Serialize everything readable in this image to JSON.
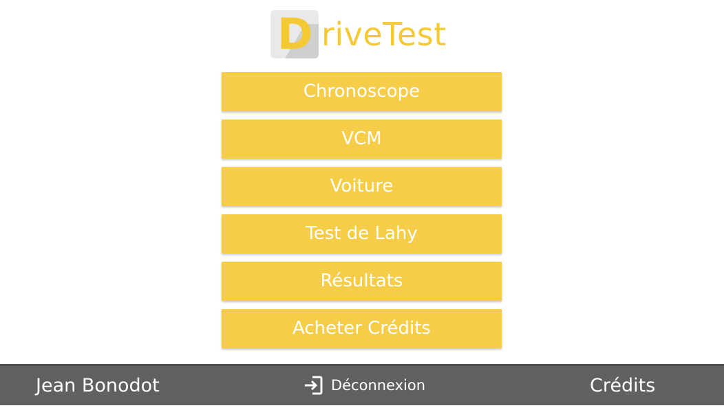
{
  "app": {
    "logo_letter": "D",
    "logo_rest": "riveTest"
  },
  "colors": {
    "accent": "#f5cd48",
    "logo": "#f5c934",
    "footer": "#606060"
  },
  "menu": {
    "items": [
      {
        "label": "Chronoscope"
      },
      {
        "label": "VCM"
      },
      {
        "label": "Voiture"
      },
      {
        "label": "Test de Lahy"
      },
      {
        "label": "Résultats"
      },
      {
        "label": "Acheter Crédits"
      }
    ]
  },
  "footer": {
    "user_name": "Jean Bonodot",
    "logout_label": "Déconnexion",
    "logout_icon": "logout-icon",
    "credits_label": "Crédits"
  }
}
